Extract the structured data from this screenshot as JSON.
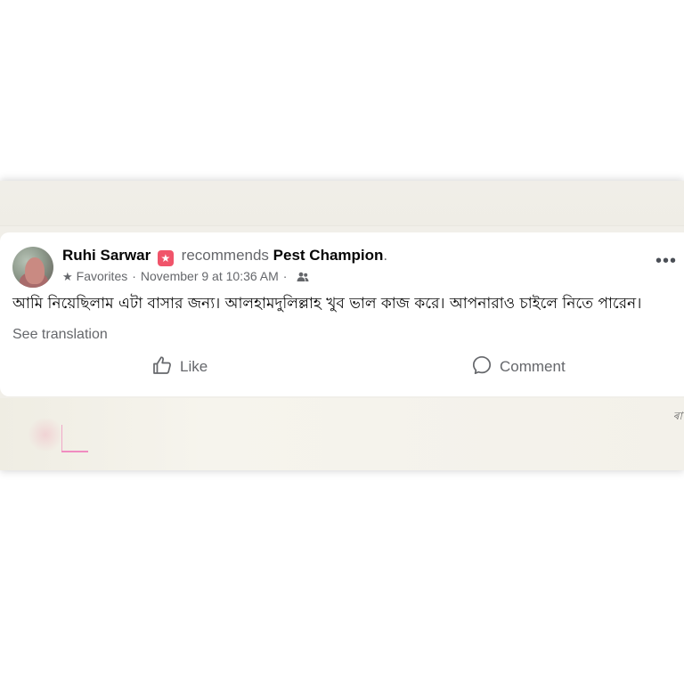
{
  "post": {
    "author": "Ruhi Sarwar",
    "verb": "recommends",
    "page": "Pest Champion",
    "page_suffix": ".",
    "audience_label": "Favorites",
    "timestamp": "November 9 at 10:36 AM",
    "body": "আমি নিয়েছিলাম এটা বাসার জন্য। আলহামদুলিল্লাহ খুব ভাল কাজ করে। আপনারাও চাইলে নিতে পারেন।",
    "see_translation": "See translation",
    "more_label": "•••"
  },
  "actions": {
    "like_label": "Like",
    "comment_label": "Comment"
  },
  "backdrop": {
    "edge_text": "ৰা"
  },
  "colors": {
    "recommend_badge": "#f0546a",
    "secondary_text": "#65676b",
    "primary_text": "#050505",
    "backdrop": "#f1efe9"
  },
  "icons": [
    "recommend-badge-icon",
    "star-icon",
    "friends-icon",
    "more-icon",
    "like-icon",
    "comment-icon"
  ]
}
